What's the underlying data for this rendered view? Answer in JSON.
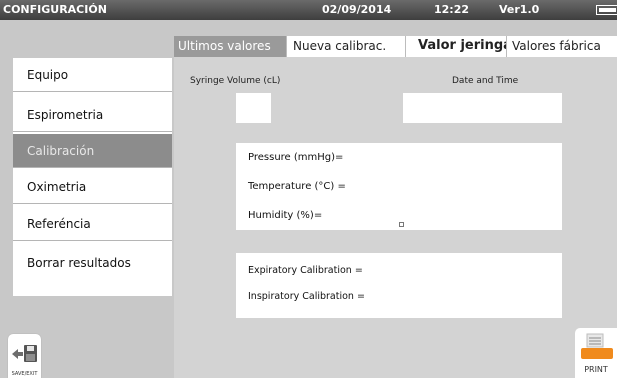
{
  "header": {
    "title": "CONFIGURACIÓN",
    "date": "02/09/2014",
    "time": "12:22",
    "version": "Ver1.0"
  },
  "sidebar": {
    "items": [
      {
        "label": "Equipo"
      },
      {
        "label": "Espirometria"
      },
      {
        "label": "Calibración"
      },
      {
        "label": "Oximetria"
      },
      {
        "label": "Referéncia"
      },
      {
        "label": "Borrar resultados"
      }
    ],
    "active": "Calibración"
  },
  "tabs": [
    {
      "label": "Ultimos valores"
    },
    {
      "label": "Nueva calibrac."
    },
    {
      "label": "Valor jeringa"
    },
    {
      "label": "Valores fábrica"
    }
  ],
  "main": {
    "syringe_label": "Syringe Volume (cL)",
    "datetime_label": "Date and Time",
    "syringe_value": "",
    "datetime_value": "",
    "readings": {
      "pressure": "Pressure (mmHg)=",
      "temperature": "Temperature (°C) =",
      "humidity": "Humidity (%)="
    },
    "calibration": {
      "expiratory": "Expiratory Calibration =",
      "inspiratory": "Inspiratory Calibration ="
    }
  },
  "buttons": {
    "save_exit": "SAVE/EXIT",
    "print": "PRINT"
  },
  "colors": {
    "titlebar": "#4a4a4a",
    "active_tab": "#9a9a9a",
    "active_sidebar": "#8c8c8c",
    "print_accent": "#f08a1c"
  },
  "icons": {
    "battery": "battery-icon",
    "save": "floppy-disk-icon",
    "print": "printer-icon"
  }
}
